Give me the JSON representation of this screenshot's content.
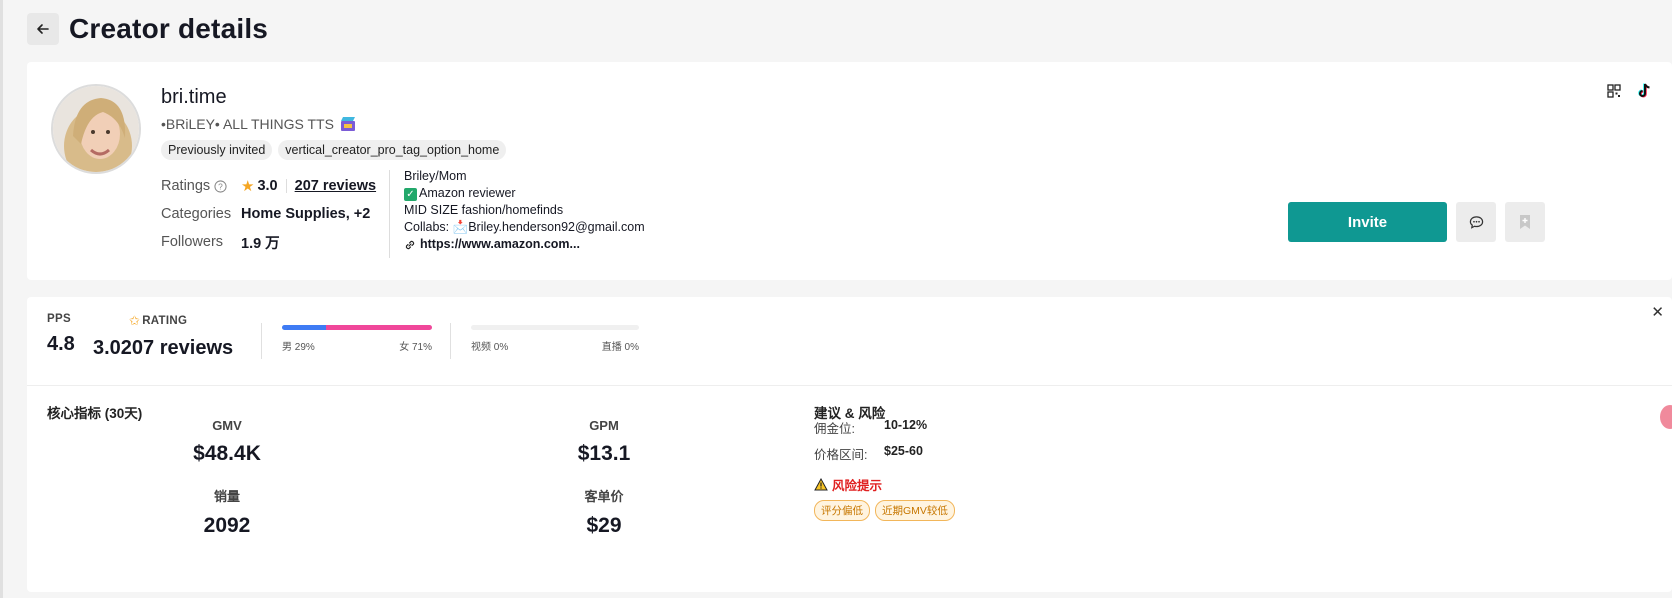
{
  "header": {
    "title": "Creator details"
  },
  "profile": {
    "name": "bri.time",
    "bio": "•BRiLEY• ALL THINGS TTS",
    "tags": [
      "Previously invited",
      "vertical_creator_pro_tag_option_home"
    ],
    "ratings_label": "Ratings",
    "rating_value": "3.0",
    "reviews_label": "207 reviews",
    "categories_label": "Categories",
    "categories_value": "Home Supplies, +2",
    "followers_label": "Followers",
    "followers_value": "1.9 万",
    "description": {
      "line1": "Briley/Mom",
      "line2": "Amazon reviewer",
      "line3": "MID SIZE fashion/homefinds",
      "line4": "Collabs: 📩Briley.henderson92@gmail.com",
      "link": "https://www.amazon.com..."
    },
    "invite_label": "Invite"
  },
  "summary": {
    "pps_label": "PPS",
    "pps_value": "4.8",
    "rating_label": "RATING",
    "rating_value": "3.0207 reviews",
    "gender": {
      "male_label": "男 29%",
      "female_label": "女 71%",
      "male_pct": 29,
      "female_pct": 71
    },
    "content": {
      "video_label": "视频 0%",
      "live_label": "直播 0%",
      "video_pct": 0
    }
  },
  "core_metrics": {
    "title": "核心指标 (30天)",
    "items": [
      {
        "label": "GMV",
        "value": "$48.4K"
      },
      {
        "label": "GPM",
        "value": "$13.1"
      },
      {
        "label": "销量",
        "value": "2092"
      },
      {
        "label": "客单价",
        "value": "$29"
      }
    ]
  },
  "advice": {
    "title": "建议 & 风险",
    "commission_label": "佣金位:",
    "commission_value": "10-12%",
    "price_label": "价格区间:",
    "price_value": "$25-60",
    "risk_title": "风险提示",
    "risk_tags": [
      "评分偏低",
      "近期GMV较低"
    ]
  },
  "colors": {
    "accent": "#0f9892",
    "male": "#3e7bf4",
    "female": "#f0479a",
    "risk": "#e02020"
  }
}
